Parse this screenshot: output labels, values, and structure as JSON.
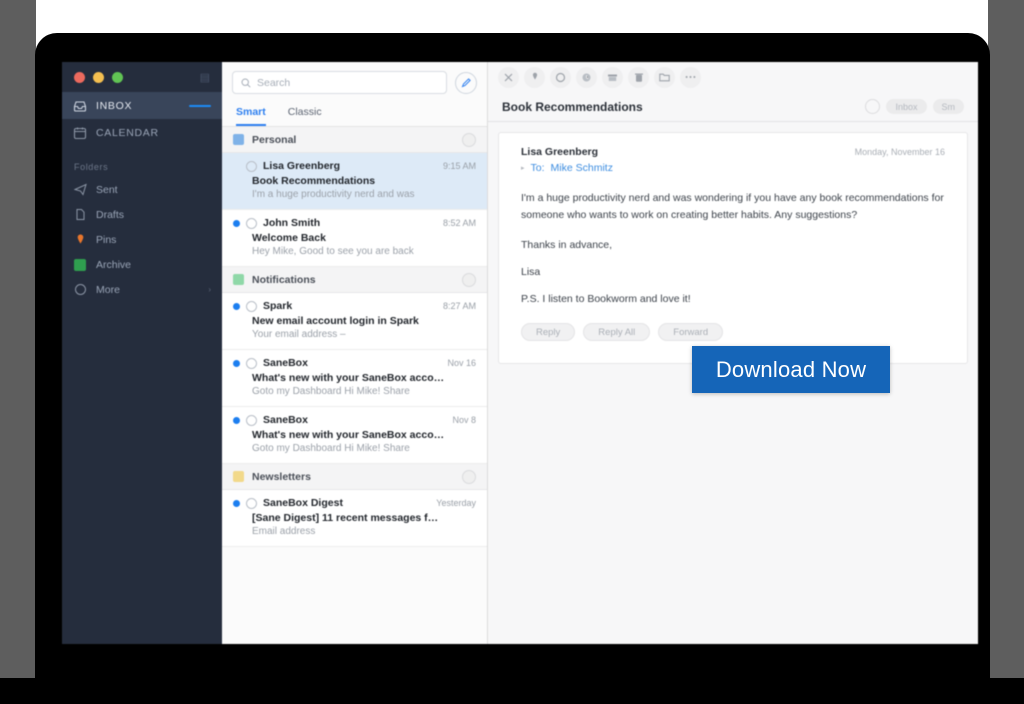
{
  "window": {
    "traffic_lights": [
      "close",
      "minimize",
      "zoom"
    ]
  },
  "sidebar": {
    "primary": [
      {
        "label": "INBOX",
        "icon": "inbox-icon",
        "badge": "",
        "active": true
      },
      {
        "label": "CALENDAR",
        "icon": "calendar-icon",
        "badge": "",
        "active": false
      }
    ],
    "section_label": "Folders",
    "folders": [
      {
        "label": "Sent",
        "icon": "sent-icon",
        "color": "#8c96a6"
      },
      {
        "label": "Drafts",
        "icon": "drafts-icon",
        "color": "#8c96a6"
      },
      {
        "label": "Pins",
        "icon": "pin-icon",
        "color": "#e8762c"
      },
      {
        "label": "Archive",
        "icon": "archive-icon",
        "color": "#2f9e4f"
      },
      {
        "label": "More",
        "icon": "more-icon",
        "color": "#8c96a6"
      }
    ]
  },
  "list": {
    "search_placeholder": "Search",
    "search_icon": "search-icon",
    "compose_icon": "compose-pencil-icon",
    "tabs": [
      {
        "label": "Smart",
        "selected": true
      },
      {
        "label": "Classic",
        "selected": false
      }
    ],
    "groups": [
      {
        "name": "Personal",
        "color": "#7fb2e8",
        "emails": [
          {
            "sender": "Lisa Greenberg",
            "subject": "Book Recommendations",
            "preview": "I'm a huge productivity nerd and was",
            "time": "9:15 AM",
            "unread": false,
            "selected": true
          },
          {
            "sender": "John Smith",
            "subject": "Welcome Back",
            "preview": "Hey Mike, Good to see you are back",
            "time": "8:52 AM",
            "unread": true,
            "selected": false
          }
        ]
      },
      {
        "name": "Notifications",
        "color": "#8fd8a8",
        "emails": [
          {
            "sender": "Spark",
            "subject": "New email account login in Spark",
            "preview": "Your email address –",
            "time": "8:27 AM",
            "unread": true,
            "selected": false
          },
          {
            "sender": "SaneBox",
            "subject": "What's new with your SaneBox acco…",
            "preview": "Goto my Dashboard Hi Mike! Share",
            "time": "Nov 16",
            "unread": true,
            "selected": false
          },
          {
            "sender": "SaneBox",
            "subject": "What's new with your SaneBox acco…",
            "preview": "Goto my Dashboard Hi Mike! Share",
            "time": "Nov 8",
            "unread": true,
            "selected": false
          }
        ]
      },
      {
        "name": "Newsletters",
        "color": "#f2d98a",
        "emails": [
          {
            "sender": "SaneBox Digest",
            "subject": "[Sane Digest] 11 recent messages f…",
            "preview": "Email address",
            "time": "Yesterday",
            "unread": true,
            "selected": false
          }
        ]
      }
    ]
  },
  "reader": {
    "toolbar_icons": [
      "close-icon",
      "pin-icon",
      "mark-unread-icon",
      "snooze-clock-icon",
      "archive-icon",
      "trash-icon",
      "move-to-folder-icon",
      "more-ellipsis-icon"
    ],
    "title": "Book Recommendations",
    "header_right": {
      "search-icon": "search-icon",
      "pill_1": "Inbox",
      "pill_2": "Sm"
    },
    "message": {
      "from": "Lisa Greenberg",
      "date": "Monday, November 16",
      "to_prefix": "To:",
      "to": "Mike Schmitz",
      "paragraph_1": "I'm a huge productivity nerd and was wondering if you have any book recommendations for someone who wants to work on creating better habits. Any suggestions?",
      "paragraph_2": "Thanks in advance,",
      "signature": "Lisa",
      "postscript": "P.S. I listen to Bookworm and love it!",
      "actions": [
        {
          "label": "Reply"
        },
        {
          "label": "Reply All"
        },
        {
          "label": "Forward"
        }
      ]
    }
  },
  "cta": {
    "label": "Download Now",
    "color": "#1565b8",
    "text_color": "#ffffff"
  }
}
